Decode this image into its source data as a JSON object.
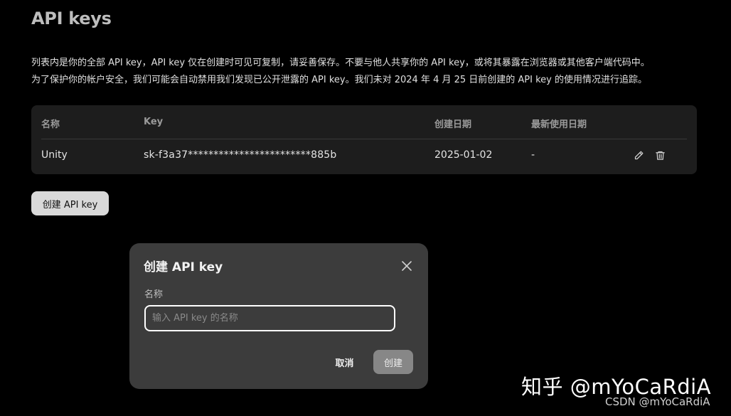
{
  "page": {
    "title": "API keys",
    "description": [
      "列表内是你的全部 API key，API key 仅在创建时可见可复制，请妥善保存。不要与他人共享你的 API key，或将其暴露在浏览器或其他客户端代码中。",
      "为了保护你的帐户安全，我们可能会自动禁用我们发现已公开泄露的 API key。我们未对 2024 年 4 月 25 日前创建的 API key 的使用情况进行追踪。"
    ]
  },
  "table": {
    "columns": {
      "name": "名称",
      "key": "Key",
      "created": "创建日期",
      "last_used": "最新使用日期"
    },
    "rows": [
      {
        "name": "Unity",
        "key": "sk-f3a37************************885b",
        "created": "2025-01-02",
        "last_used": "-",
        "actions": {
          "edit_icon": "pencil-icon",
          "delete_icon": "trash-icon"
        }
      }
    ]
  },
  "create_button": {
    "label": "创建 API key"
  },
  "dialog": {
    "title": "创建 API key",
    "close_icon": "close-icon",
    "name_label": "名称",
    "name_input": {
      "value": "",
      "placeholder": "输入 API key 的名称"
    },
    "cancel_label": "取消",
    "confirm_label": "创建"
  },
  "watermark": {
    "main": "知乎 @mYoCaRdiA",
    "sub": "CSDN @mYoCaRdiA"
  },
  "colors": {
    "background": "#000000",
    "table_bg": "#1d1d1d",
    "dialog_bg": "#3c3c3c",
    "create_button_bg": "#d9d9d9",
    "confirm_button_bg": "#878787",
    "input_border": "#ffffff"
  }
}
